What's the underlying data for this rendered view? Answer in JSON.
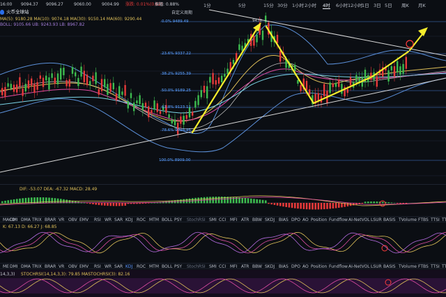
{
  "top_bar": {
    "time_left": "16:00",
    "price_o": "9094.37",
    "price_h": "9096.27",
    "price_l": "9060.00",
    "price_c": "9004.99",
    "change": "涨跌: 0.01%(0.62)",
    "amp": "振幅: 0.88%",
    "custom_period": "自定义周期",
    "period_tabs": [
      "30分",
      "1小时",
      "2小时",
      "4小时",
      "6小时",
      "12小时",
      "1日",
      "3日",
      "5日"
    ],
    "left_tabs": [
      "1分",
      "5分",
      "15分"
    ],
    "week": "周K",
    "month": "月K",
    "active_tab": "4时"
  },
  "header": {
    "logo_text": "火币全球站",
    "ma_line": "MA(5): 9180.28  MA(10): 9074.18  MA(30): 9150.14  MA(60): 9290.44",
    "boll_line": "BOLL: 9105.66  UB: 9243.93  LB: 8967.82"
  },
  "fib_levels": [
    {
      "label": "0.0% 9489.49"
    },
    {
      "label": "23.6% 9337.22"
    },
    {
      "label": "38.2% 9255.39"
    },
    {
      "label": "50.0% 9189.25"
    },
    {
      "label": "61.8% 9123.11"
    },
    {
      "label": "78.6% 9028.95"
    },
    {
      "label": "100.0% 8909.00"
    }
  ],
  "peak_label": "9478",
  "macd": {
    "values": "DIF: -53.07  DEA: -67.32  MACD: 28.49"
  },
  "kdj": {
    "values": "K: 67.13  D: 66.27  J: 68.85"
  },
  "stochrsi": {
    "values": "STOCHRSI(14,14,3,3): 79.85  MASTOCHRSI(3): 82.16",
    "prefix": "14,3,3)"
  },
  "indicator_row_1": [
    "MACD",
    "DMI",
    "DMA",
    "TRIX",
    "BRAR",
    "VR",
    "OBV",
    "EMV",
    "RSI",
    "WR",
    "SAR",
    "KDJ",
    "ROC",
    "MTM",
    "BOLL",
    "PSY",
    "StochRSI",
    "SMI",
    "CCI",
    "MFI",
    "ATR",
    "BBW",
    "SKDJ",
    "BIAS",
    "DPO",
    "AO",
    "Position",
    "Fundflow",
    "AI-NetVOL",
    "LSUR",
    "BASIS",
    "TVolume",
    "FTBS",
    "TTSI",
    "TTMU"
  ],
  "indicator_row_2": [
    "ME",
    "DMI",
    "DMA",
    "TRIX",
    "BRAR",
    "VR",
    "OBV",
    "EMV",
    "RSI",
    "WR",
    "SAR",
    "KDJ",
    "ROC",
    "MTM",
    "BOLL",
    "PSY",
    "StochRSI",
    "SMI",
    "CCI",
    "MFI",
    "ATR",
    "BBW",
    "SKDJ",
    "BIAS",
    "DPO",
    "AO",
    "Position",
    "Fundflow",
    "AI-NetVOL",
    "LSUR",
    "BASIS",
    "TVolume",
    "FTBS",
    "TTSI",
    "TTMU"
  ],
  "colors": {
    "up": "#e63a3a",
    "down": "#3dbb4f",
    "arrow": "#f4ec2c",
    "fib": "#5a96ff",
    "trendline": "#d9d9d9"
  }
}
